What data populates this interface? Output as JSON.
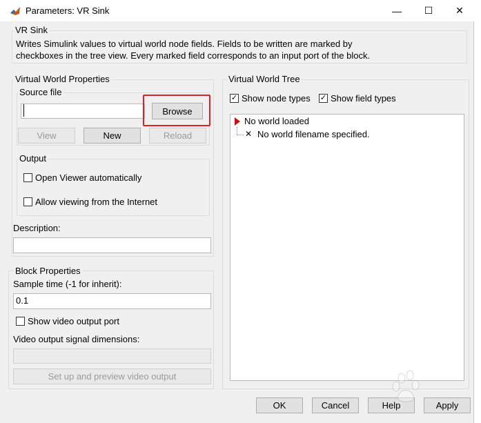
{
  "window": {
    "title": "Parameters: VR Sink",
    "minimize_glyph": "—",
    "maximize_glyph": "☐",
    "close_glyph": "✕"
  },
  "description_group": {
    "label": "VR Sink",
    "text_line1": "Writes Simulink values to virtual world node fields. Fields to be written are marked by",
    "text_line2": "checkboxes in the tree view. Every marked field corresponds to an input port of the block."
  },
  "vw_properties": {
    "label": "Virtual World Properties",
    "source_file": {
      "label": "Source file",
      "value": "",
      "browse_label": "Browse",
      "view_label": "View",
      "new_label": "New",
      "reload_label": "Reload"
    },
    "output": {
      "label": "Output",
      "open_viewer_label": "Open Viewer automatically",
      "open_viewer_checked": false,
      "allow_internet_label": "Allow viewing from the Internet",
      "allow_internet_checked": false
    },
    "description": {
      "label": "Description:",
      "value": ""
    }
  },
  "block_properties": {
    "label": "Block Properties",
    "sample_time_label": "Sample time (-1 for inherit):",
    "sample_time_value": "0.1",
    "show_video_label": "Show video output port",
    "show_video_checked": false,
    "video_dims_label": "Video output signal dimensions:",
    "video_dims_value": "",
    "setup_button_label": "Set up and preview video output"
  },
  "vw_tree": {
    "label": "Virtual World Tree",
    "show_node_types_label": "Show node types",
    "show_node_types_checked": true,
    "show_field_types_label": "Show field types",
    "show_field_types_checked": true,
    "root_label": "No world loaded",
    "child_label": "No world filename specified."
  },
  "footer": {
    "ok_label": "OK",
    "cancel_label": "Cancel",
    "help_label": "Help",
    "apply_label": "Apply"
  },
  "colors": {
    "highlight": "#e02020",
    "tree_arrow": "#d01010",
    "window_bg": "#f0f0f0"
  }
}
